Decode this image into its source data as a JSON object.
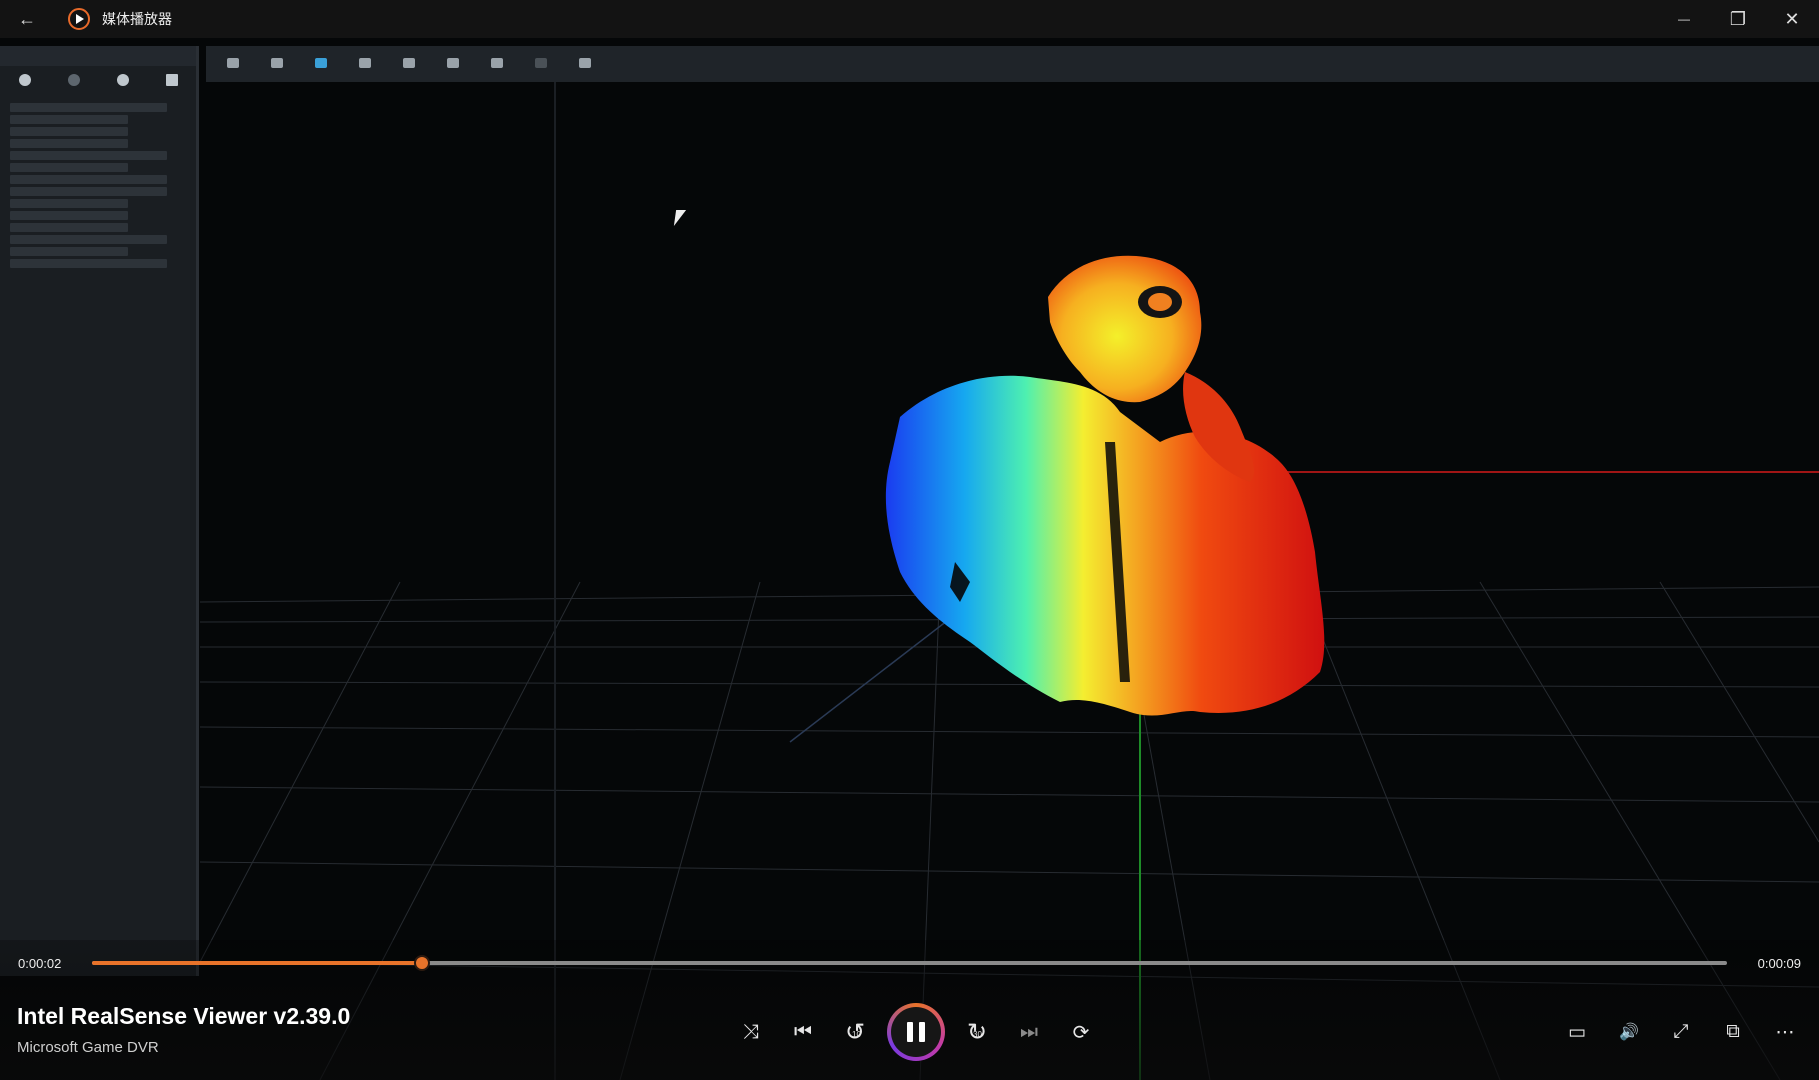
{
  "window": {
    "title": "媒体播放器",
    "back_glyph": "←",
    "minimize_glyph": "—",
    "maximize_glyph": "❐",
    "close_glyph": "✕"
  },
  "playback": {
    "current_time": "0:00:02",
    "total_time": "0:00:09",
    "progress": 0.202
  },
  "media": {
    "title": "Intel RealSense Viewer v2.39.0",
    "subtitle": "Microsoft Game DVR"
  },
  "controls": {
    "shuffle_glyph": "⤨",
    "previous_glyph": "⏮",
    "rewind_glyph": "↺",
    "rewind_seconds": "10",
    "forward_glyph": "↻",
    "forward_seconds": "30",
    "next_glyph": "⏭",
    "repeat_glyph": "⟳",
    "subtitles_glyph": "▭",
    "volume_glyph": "🔊",
    "fullscreen_glyph": "⤢",
    "miniplayer_glyph": "⧉",
    "more_glyph": "⋯"
  },
  "colors": {
    "accent": "#e8732a",
    "titlebar": "#131313"
  },
  "icons": [
    "back-arrow-icon",
    "media-player-icon",
    "minimize-icon",
    "maximize-icon",
    "close-icon",
    "shuffle-icon",
    "previous-icon",
    "rewind-10-icon",
    "pause-icon",
    "forward-30-icon",
    "next-icon",
    "repeat-icon",
    "subtitles-icon",
    "volume-icon",
    "fullscreen-icon",
    "miniplayer-icon",
    "more-icon"
  ]
}
